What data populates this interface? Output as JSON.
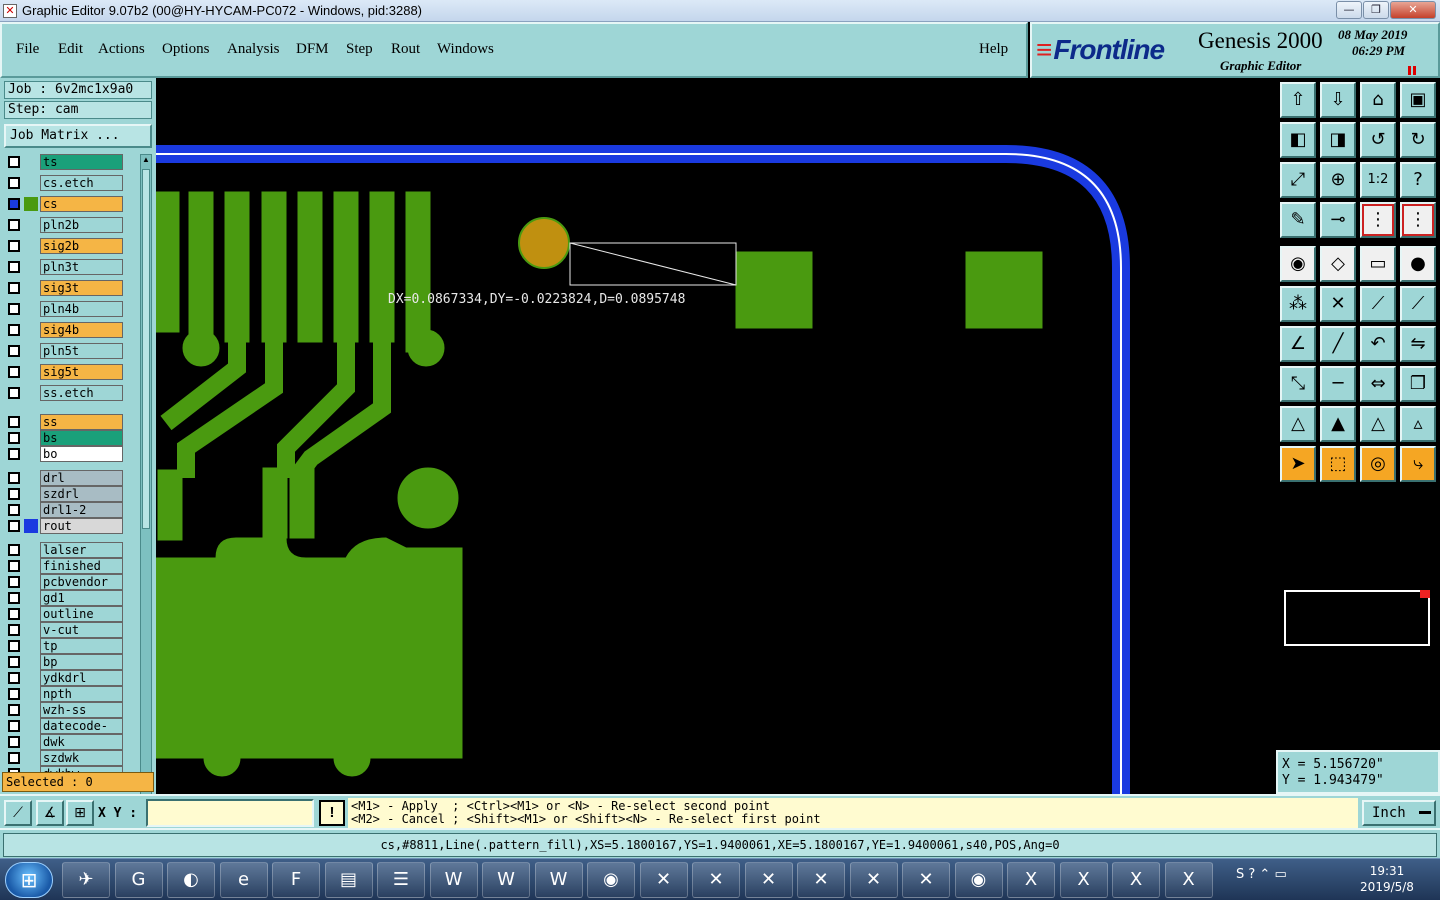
{
  "window": {
    "title": "Graphic Editor 9.07b2 (00@HY-HYCAM-PC072 - Windows, pid:3288)",
    "controls": [
      "—",
      "❐",
      "✕"
    ]
  },
  "menu": {
    "items": [
      {
        "label": "File"
      },
      {
        "label": "Edit"
      },
      {
        "label": "Actions"
      },
      {
        "label": "Options"
      },
      {
        "label": "Analysis"
      },
      {
        "label": "DFM"
      },
      {
        "label": "Step"
      },
      {
        "label": "Rout"
      },
      {
        "label": "Windows"
      }
    ],
    "help": "Help"
  },
  "brand": {
    "logo": "Frontline",
    "product": "Genesis 2000",
    "subtitle": "Graphic Editor",
    "date": "08 May 2019",
    "time": "06:29 PM"
  },
  "job": {
    "job_label": "Job : 6v2mc1x9a0",
    "step_label": "Step: cam",
    "matrix_button": "Job Matrix ..."
  },
  "layers": [
    {
      "name": "ts",
      "color": "#1aa07a",
      "swatch": "",
      "group": 0
    },
    {
      "name": "cs.etch",
      "color": "#9ed6d6",
      "swatch": "",
      "group": 0
    },
    {
      "name": "cs",
      "color": "#f5b545",
      "swatch": "#4a9a10",
      "group": 0,
      "active": true
    },
    {
      "name": "pln2b",
      "color": "#9ed6d6",
      "swatch": "",
      "group": 0
    },
    {
      "name": "sig2b",
      "color": "#f5b545",
      "swatch": "",
      "group": 0
    },
    {
      "name": "pln3t",
      "color": "#9ed6d6",
      "swatch": "",
      "group": 0
    },
    {
      "name": "sig3t",
      "color": "#f5b545",
      "swatch": "",
      "group": 0
    },
    {
      "name": "pln4b",
      "color": "#9ed6d6",
      "swatch": "",
      "group": 0
    },
    {
      "name": "sig4b",
      "color": "#f5b545",
      "swatch": "",
      "group": 0
    },
    {
      "name": "pln5t",
      "color": "#9ed6d6",
      "swatch": "",
      "group": 0
    },
    {
      "name": "sig5t",
      "color": "#f5b545",
      "swatch": "",
      "group": 0
    },
    {
      "name": "ss.etch",
      "color": "#9ed6d6",
      "swatch": "",
      "group": 0
    },
    {
      "name": "ss",
      "color": "#f5b545",
      "swatch": "",
      "group": 1
    },
    {
      "name": "bs",
      "color": "#1aa07a",
      "swatch": "",
      "group": 1
    },
    {
      "name": "bo",
      "color": "#ffffff",
      "swatch": "",
      "group": 1
    },
    {
      "name": "drl",
      "color": "#a8bcc4",
      "swatch": "",
      "group": 2
    },
    {
      "name": "szdrl",
      "color": "#a8bcc4",
      "swatch": "",
      "group": 2
    },
    {
      "name": "drl1-2",
      "color": "#a8bcc4",
      "swatch": "",
      "group": 2
    },
    {
      "name": "rout",
      "color": "#d8d8d8",
      "swatch": "#1a3ae0",
      "group": 2
    },
    {
      "name": "lalser",
      "color": "#9ed6d6",
      "swatch": "",
      "group": 3
    },
    {
      "name": "finished",
      "color": "#9ed6d6",
      "swatch": "",
      "group": 3
    },
    {
      "name": "pcbvendor",
      "color": "#9ed6d6",
      "swatch": "",
      "group": 3
    },
    {
      "name": "gd1",
      "color": "#9ed6d6",
      "swatch": "",
      "group": 3
    },
    {
      "name": "outline",
      "color": "#9ed6d6",
      "swatch": "",
      "group": 3
    },
    {
      "name": "v-cut",
      "color": "#9ed6d6",
      "swatch": "",
      "group": 3
    },
    {
      "name": "tp",
      "color": "#9ed6d6",
      "swatch": "",
      "group": 3
    },
    {
      "name": "bp",
      "color": "#9ed6d6",
      "swatch": "",
      "group": 3
    },
    {
      "name": "ydkdrl",
      "color": "#9ed6d6",
      "swatch": "",
      "group": 3
    },
    {
      "name": "npth",
      "color": "#9ed6d6",
      "swatch": "",
      "group": 3
    },
    {
      "name": "wzh-ss",
      "color": "#9ed6d6",
      "swatch": "",
      "group": 3
    },
    {
      "name": "datecode-ss",
      "color": "#9ed6d6",
      "swatch": "",
      "group": 3
    },
    {
      "name": "dwk",
      "color": "#9ed6d6",
      "swatch": "",
      "group": 3
    },
    {
      "name": "szdwk",
      "color": "#9ed6d6",
      "swatch": "",
      "group": 3
    },
    {
      "name": "dwkbw",
      "color": "#9ed6d6",
      "swatch": "",
      "group": 3
    }
  ],
  "selected_label": "Selected : 0",
  "measure": "DX=0.0867334,DY=-0.0223824,D=0.0895748",
  "colors": {
    "copper": "#4a9a10",
    "rout": "#1a3ae0",
    "pad_highlight": "#c09010"
  },
  "tools": [
    {
      "icon": "open-step-icon",
      "glyph": "⇧",
      "style": "teal"
    },
    {
      "icon": "save-step-icon",
      "glyph": "⇩",
      "style": "teal"
    },
    {
      "icon": "home-icon",
      "glyph": "⌂",
      "style": "teal"
    },
    {
      "icon": "window-icon",
      "glyph": "▣",
      "style": "teal"
    },
    {
      "icon": "layer-left-icon",
      "glyph": "◧",
      "style": "teal"
    },
    {
      "icon": "layer-right-icon",
      "glyph": "◨",
      "style": "teal"
    },
    {
      "icon": "undo-icon",
      "glyph": "↺",
      "style": "teal"
    },
    {
      "icon": "redo-icon",
      "glyph": "↻",
      "style": "teal"
    },
    {
      "icon": "zoom-fit-icon",
      "glyph": "⤢",
      "style": "teal"
    },
    {
      "icon": "zoom-center-icon",
      "glyph": "⊕",
      "style": "teal"
    },
    {
      "icon": "scale-1-2-icon",
      "glyph": "1:2",
      "style": "teal"
    },
    {
      "icon": "help-icon",
      "glyph": "?",
      "style": "teal"
    },
    {
      "icon": "measure-tool-icon",
      "glyph": "✎",
      "style": "teal"
    },
    {
      "icon": "probe-icon",
      "glyph": "⊸",
      "style": "teal"
    },
    {
      "icon": "net-icon",
      "glyph": "⋮",
      "style": "red-outline"
    },
    {
      "icon": "net-alt-icon",
      "glyph": "⋮",
      "style": "red-outline"
    },
    {
      "icon": "pad-add-icon",
      "glyph": "◉",
      "style": "white"
    },
    {
      "icon": "line-add-icon",
      "glyph": "◇",
      "style": "white"
    },
    {
      "icon": "ruler-icon",
      "glyph": "▭",
      "style": "white"
    },
    {
      "icon": "circle-fill-icon",
      "glyph": "●",
      "style": "white"
    },
    {
      "icon": "connect-nodes-icon",
      "glyph": "⁂",
      "style": "teal"
    },
    {
      "icon": "cross-icon",
      "glyph": "✕",
      "style": "teal"
    },
    {
      "icon": "segment-icon",
      "glyph": "⟋",
      "style": "teal"
    },
    {
      "icon": "segment-alt-icon",
      "glyph": "⟋",
      "style": "teal"
    },
    {
      "icon": "angle-icon",
      "glyph": "∠",
      "style": "teal"
    },
    {
      "icon": "slash-icon",
      "glyph": "╱",
      "style": "teal"
    },
    {
      "icon": "rotate-icon",
      "glyph": "↶",
      "style": "teal"
    },
    {
      "icon": "mirror-icon",
      "glyph": "⇋",
      "style": "teal"
    },
    {
      "icon": "move-icon",
      "glyph": "⤡",
      "style": "teal"
    },
    {
      "icon": "dash-icon",
      "glyph": "─",
      "style": "teal"
    },
    {
      "icon": "stretch-icon",
      "glyph": "⇔",
      "style": "teal"
    },
    {
      "icon": "copy-icon",
      "glyph": "❐",
      "style": "teal"
    },
    {
      "icon": "triangle-icon",
      "glyph": "△",
      "style": "teal"
    },
    {
      "icon": "triangle-up-icon",
      "glyph": "▲",
      "style": "teal"
    },
    {
      "icon": "triangle-outline-icon",
      "glyph": "△",
      "style": "teal"
    },
    {
      "icon": "triangle-blue-icon",
      "glyph": "▵",
      "style": "teal"
    },
    {
      "icon": "pointer-icon",
      "glyph": "➤",
      "style": "orange"
    },
    {
      "icon": "pointer-box-icon",
      "glyph": "⬚",
      "style": "orange"
    },
    {
      "icon": "pointer-circle-icon",
      "glyph": "◎",
      "style": "orange"
    },
    {
      "icon": "pointer-path-icon",
      "glyph": "⤷",
      "style": "orange"
    }
  ],
  "coords": {
    "x": "X = 5.156720\"",
    "y": "Y = 1.943479\""
  },
  "prompt": {
    "xy_label": "X Y :",
    "xy_value": "",
    "warn": "!",
    "line1": "<M1> - Apply  ; <Ctrl><M1> or <N> - Re-select second point",
    "line2": "<M2> - Cancel ; <Shift><M1> or <Shift><N> - Re-select first point",
    "unit": "Inch"
  },
  "status": "cs,#8811,Line(.pattern_fill),XS=5.1800167,YS=1.9400061,XE=5.1800167,YE=1.9400061,s40,POS,Ang=0",
  "taskbar": {
    "apps": [
      {
        "icon": "twitter-bird-icon",
        "glyph": "✈"
      },
      {
        "icon": "app-red-icon",
        "glyph": "G"
      },
      {
        "icon": "shell-icon",
        "glyph": "◐"
      },
      {
        "icon": "ie-icon",
        "glyph": "e"
      },
      {
        "icon": "frontline-icon",
        "glyph": "F"
      },
      {
        "icon": "floppy-icon",
        "glyph": "▤"
      },
      {
        "icon": "stack-icon",
        "glyph": "☰"
      },
      {
        "icon": "word-icon",
        "glyph": "W"
      },
      {
        "icon": "word-icon",
        "glyph": "W"
      },
      {
        "icon": "word-icon",
        "glyph": "W"
      },
      {
        "icon": "eye-icon",
        "glyph": "◉"
      },
      {
        "icon": "x-window-icon",
        "glyph": "✕"
      },
      {
        "icon": "x-window-icon",
        "glyph": "✕"
      },
      {
        "icon": "x-window-icon",
        "glyph": "✕"
      },
      {
        "icon": "x-window-icon",
        "glyph": "✕"
      },
      {
        "icon": "x-window-icon",
        "glyph": "✕"
      },
      {
        "icon": "x-window-icon",
        "glyph": "✕"
      },
      {
        "icon": "eye-icon",
        "glyph": "◉"
      },
      {
        "icon": "excel-icon",
        "glyph": "X"
      },
      {
        "icon": "excel-icon",
        "glyph": "X"
      },
      {
        "icon": "excel-icon",
        "glyph": "X"
      },
      {
        "icon": "excel-icon",
        "glyph": "X"
      }
    ],
    "tray": "S ? ⌃ ▭",
    "time": "19:31",
    "date": "2019/5/8"
  }
}
